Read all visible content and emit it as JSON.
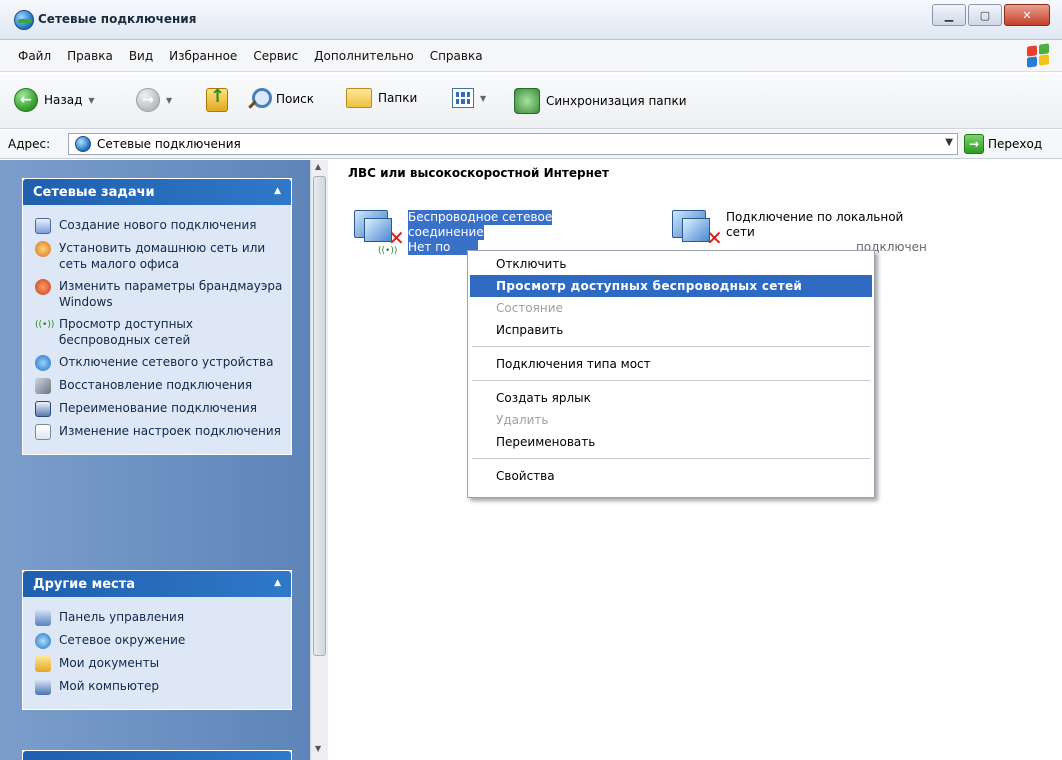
{
  "window": {
    "title": "Сетевые подключения"
  },
  "menubar": [
    "Файл",
    "Правка",
    "Вид",
    "Избранное",
    "Сервис",
    "Дополнительно",
    "Справка"
  ],
  "toolbar": {
    "back": "Назад",
    "search": "Поиск",
    "folders": "Папки",
    "sync": "Синхронизация папки"
  },
  "address": {
    "label": "Адрес:",
    "value": "Сетевые подключения",
    "go": "Переход"
  },
  "network_tasks": {
    "title": "Сетевые задачи",
    "items": [
      "Создание нового подключения",
      "Установить домашнюю сеть или сеть малого офиса",
      "Изменить параметры брандмауэра Windows",
      "Просмотр доступных беспроводных сетей",
      "Отключение сетевого устройства",
      "Восстановление подключения",
      "Переименование подключения",
      "Изменение настроек подключения"
    ]
  },
  "other_places": {
    "title": "Другие места",
    "items": [
      "Панель управления",
      "Сетевое окружение",
      "Мои документы",
      "Мой компьютер"
    ]
  },
  "main": {
    "group_title": "ЛВС или высокоскоростной Интернет",
    "wireless": {
      "line1": "Беспроводное сетевое",
      "line2": "соединение",
      "line3": "Нет по"
    },
    "lan": {
      "line1": "Подключение по локальной",
      "line2": "сети",
      "line3": "подключен"
    }
  },
  "context_menu": {
    "items": [
      {
        "label": "Отключить",
        "state": "normal"
      },
      {
        "label": "Просмотр доступных беспроводных сетей",
        "state": "highlighted"
      },
      {
        "label": "Состояние",
        "state": "disabled"
      },
      {
        "label": "Исправить",
        "state": "normal"
      },
      {
        "label": "Подключения типа мост",
        "state": "normal"
      },
      {
        "label": "Создать ярлык",
        "state": "normal"
      },
      {
        "label": "Удалить",
        "state": "disabled"
      },
      {
        "label": "Переименовать",
        "state": "normal"
      },
      {
        "label": "Свойства",
        "state": "normal"
      }
    ]
  },
  "colors": {
    "highlight": "#2f6ac2",
    "panel_header": "#1f5fae",
    "left_pane": "#6b8fc2"
  }
}
